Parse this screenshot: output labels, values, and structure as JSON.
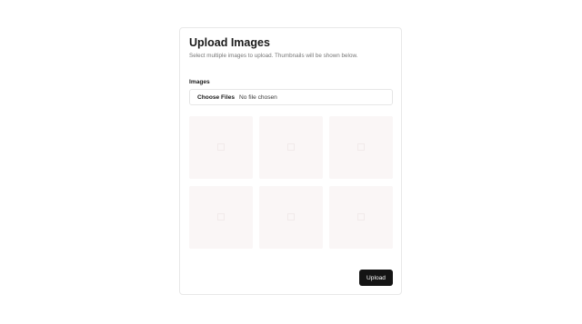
{
  "form": {
    "title": "Upload Images",
    "subtitle": "Select multiple images to upload. Thumbnails will be shown below.",
    "field_label": "Images",
    "file_input": {
      "button_label": "Choose Files",
      "status_text": "No file chosen"
    },
    "thumbnails": [
      {
        "icon": "image-placeholder-icon"
      },
      {
        "icon": "image-placeholder-icon"
      },
      {
        "icon": "image-placeholder-icon"
      },
      {
        "icon": "image-placeholder-icon"
      },
      {
        "icon": "image-placeholder-icon"
      },
      {
        "icon": "image-placeholder-icon"
      }
    ],
    "submit_label": "Upload"
  },
  "colors": {
    "thumbnail_bg": "#faf6f6",
    "button_bg": "#141414",
    "button_text": "#ffffff",
    "border": "#e8e8e8"
  }
}
